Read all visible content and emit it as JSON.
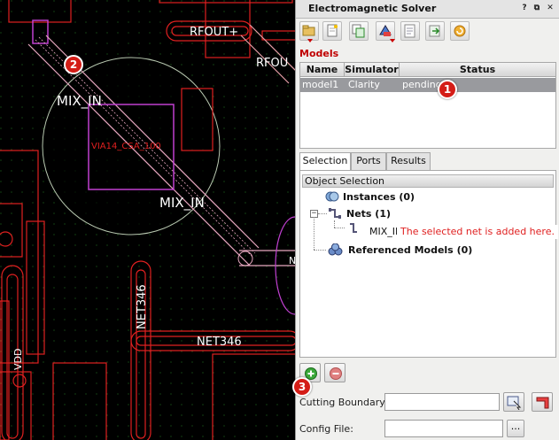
{
  "canvas": {
    "labels": {
      "rfout_plus": "RFOUT+",
      "rfout_cut": "RFOU",
      "mix_in_top": "MIX_IN",
      "mix_in_bottom": "MIX_IN",
      "via": "VIA14_CSA_100",
      "net346_vertical": "NET346",
      "net346_horizontal": "NET346",
      "vdd": "VDD",
      "edge_n": "N"
    },
    "colors": {
      "background": "#000000",
      "grid": "#1f6b1f",
      "trace": "#e02020",
      "net_highlight": "#c040d0",
      "circle": "#b8c8b0"
    }
  },
  "panel": {
    "title": "Electromagnetic Solver",
    "window_buttons": [
      "?",
      "⧉",
      "✕"
    ],
    "models_label": "Models",
    "models_table": {
      "columns": [
        "Name",
        "Simulator",
        "Status"
      ],
      "rows": [
        {
          "name": "model1",
          "simulator": "Clarity",
          "status": "pending"
        }
      ]
    },
    "tabs": [
      "Selection",
      "Ports",
      "Results"
    ],
    "active_tab": "Selection",
    "object_selection_header": "Object Selection",
    "tree": {
      "instances": "Instances (0)",
      "nets": "Nets (1)",
      "net_item": "MIX_IN",
      "referenced": "Referenced Models (0)"
    },
    "annotation_text": "The selected net is added here.",
    "cutting_boundary_label": "Cutting Boundary:",
    "config_file_label": "Config File:",
    "config_browse_label": "...",
    "cutting_boundary_value": "",
    "config_file_value": ""
  },
  "callouts": [
    "1",
    "2",
    "3"
  ],
  "colors": {
    "accent_red": "#c00000",
    "selected_row": "#999a9e",
    "callout": "#d41d17"
  }
}
